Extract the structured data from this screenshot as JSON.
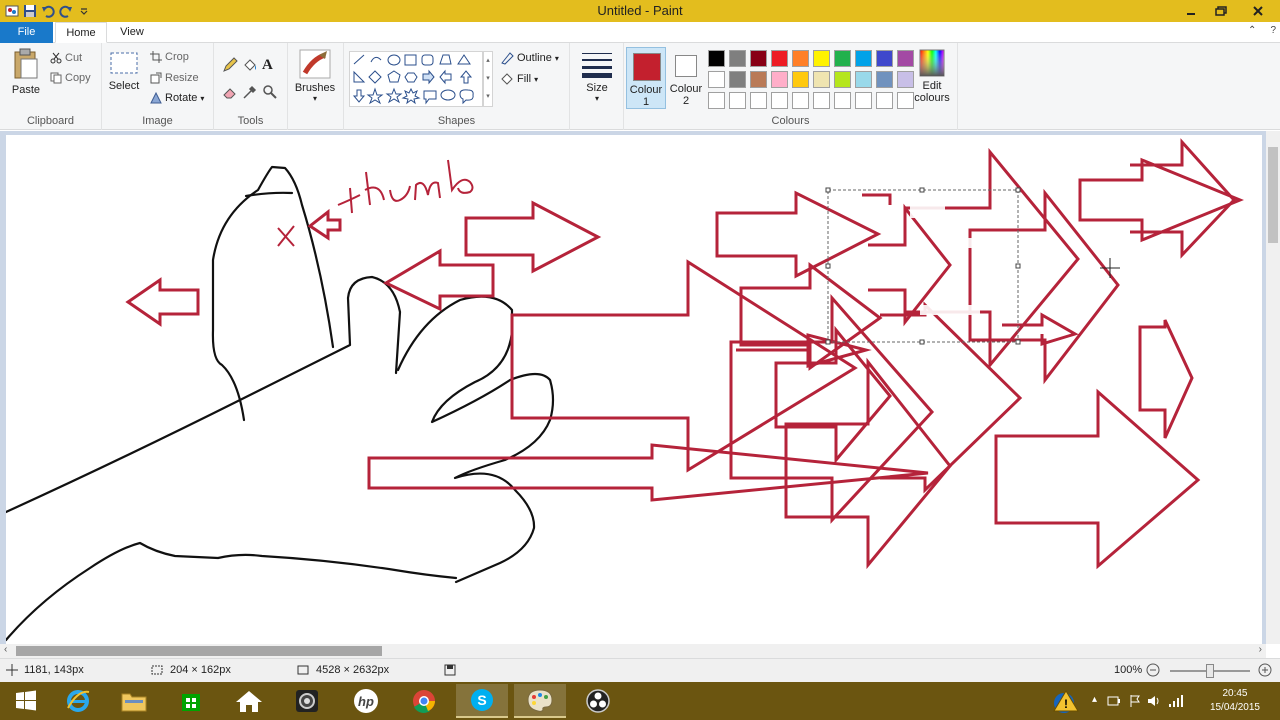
{
  "window": {
    "title": "Untitled - Paint"
  },
  "tabs": {
    "file": "File",
    "home": "Home",
    "view": "View"
  },
  "ribbon": {
    "clipboard": {
      "paste": "Paste",
      "cut": "Cut",
      "copy": "Copy",
      "label": "Clipboard"
    },
    "image": {
      "select": "Select",
      "crop": "Crop",
      "resize": "Resize",
      "rotate": "Rotate",
      "label": "Image"
    },
    "tools": {
      "label": "Tools"
    },
    "brushes": {
      "label": "Brushes"
    },
    "shapes": {
      "outline": "Outline",
      "fill": "Fill",
      "label": "Shapes"
    },
    "size": {
      "label": "Size"
    },
    "colours": {
      "colour1": "Colour",
      "colour1_num": "1",
      "colour2": "Colour",
      "colour2_num": "2",
      "edit": "Edit",
      "edit2": "colours",
      "label": "Colours",
      "colour1_value": "#c3202e",
      "colour2_value": "#ffffff",
      "palette_row1": [
        "#000000",
        "#7f7f7f",
        "#880015",
        "#ed1c24",
        "#ff7f27",
        "#fff200",
        "#22b14c",
        "#00a2e8",
        "#3f48cc",
        "#a349a4"
      ],
      "palette_row2": [
        "#ffffff",
        "#7f7f7f",
        "#b97a57",
        "#ffaec9",
        "#ffc90e",
        "#efe4b0",
        "#b5e61d",
        "#99d9ea",
        "#7092be",
        "#c8bfe7"
      ]
    }
  },
  "canvas": {
    "stroke_color": "#b5233a",
    "annotation": "Thumb"
  },
  "status": {
    "cursor": "1181, 143px",
    "selection": "204 × 162px",
    "image_size": "4528 × 2632px",
    "zoom": "100%"
  },
  "taskbar": {
    "time": "20:45",
    "date": "15/04/2015"
  }
}
